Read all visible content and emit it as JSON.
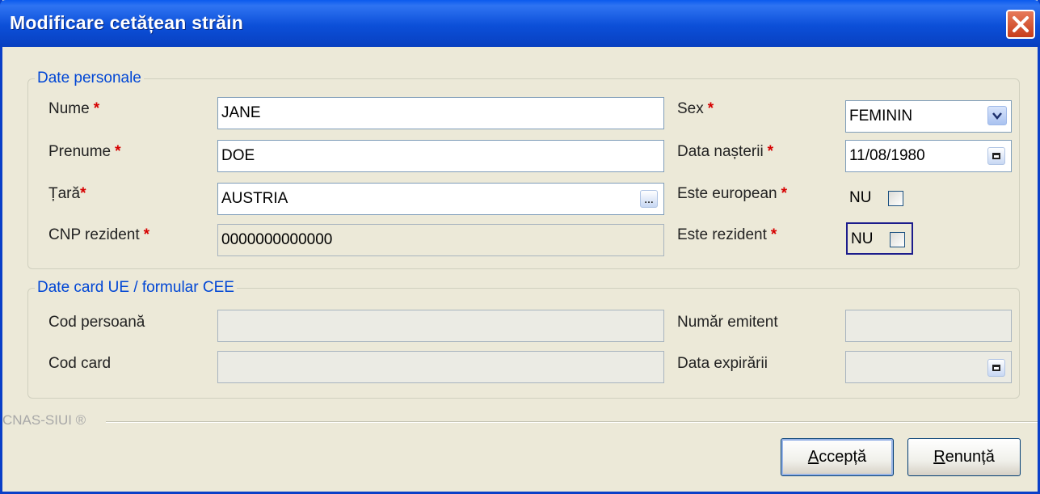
{
  "window": {
    "title": "Modificare cetățean străin"
  },
  "personal": {
    "legend": "Date personale",
    "nume_label": "Nume",
    "nume_value": "JANE",
    "prenume_label": "Prenume",
    "prenume_value": "DOE",
    "tara_label": "Țară",
    "tara_value": "AUSTRIA",
    "cnp_label": "CNP rezident",
    "cnp_value": "0000000000000",
    "sex_label": "Sex",
    "sex_value": "FEMININ",
    "data_nasterii_label": "Data nașterii",
    "data_nasterii_value": "11/08/1980",
    "european_label": "Este european",
    "european_value": "NU",
    "rezident_label": "Este rezident",
    "rezident_value": "NU",
    "required_mark": "*"
  },
  "card": {
    "legend": "Date card UE / formular CEE",
    "cod_persoana_label": "Cod persoană",
    "cod_persoana_value": "",
    "cod_card_label": "Cod card",
    "cod_card_value": "",
    "numar_emitent_label": "Număr emitent",
    "numar_emitent_value": "",
    "data_expirarii_label": "Data expirării",
    "data_expirarii_value": ""
  },
  "footer": {
    "brand": "CNAS-SIUI ®"
  },
  "buttons": {
    "accept_first": "A",
    "accept_rest": "ccepță",
    "cancel_first": "R",
    "cancel_rest": "enunță"
  },
  "icons": {
    "close": "close-icon",
    "dropdown": "chevron-down-icon",
    "calendar": "calendar-icon",
    "browse": "ellipsis-icon"
  },
  "colors": {
    "titlebar": "#0a5bee",
    "background": "#ece9d8",
    "legend_text": "#0046d5",
    "required": "#d60000"
  }
}
